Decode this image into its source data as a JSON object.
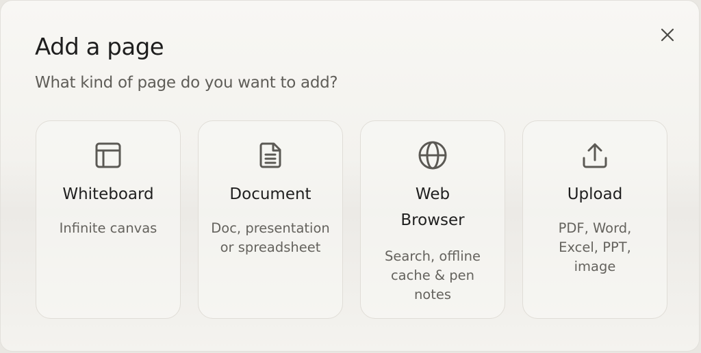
{
  "dialog": {
    "title": "Add a page",
    "subtitle": "What kind of page do you want to add?",
    "close_icon": "close-icon"
  },
  "options": [
    {
      "icon": "layout-icon",
      "title": "Whiteboard",
      "description": "Infinite canvas"
    },
    {
      "icon": "document-icon",
      "title": "Document",
      "description": "Doc, presentation or spreadsheet"
    },
    {
      "icon": "globe-icon",
      "title": "Web Browser",
      "description": "Search, offline cache & pen notes"
    },
    {
      "icon": "upload-icon",
      "title": "Upload",
      "description": "PDF, Word, Excel, PPT, image"
    }
  ],
  "colors": {
    "icon": "#5b5954",
    "title": "#1e1e1e",
    "muted": "#64625d",
    "card_border": "#e0ddd7"
  }
}
